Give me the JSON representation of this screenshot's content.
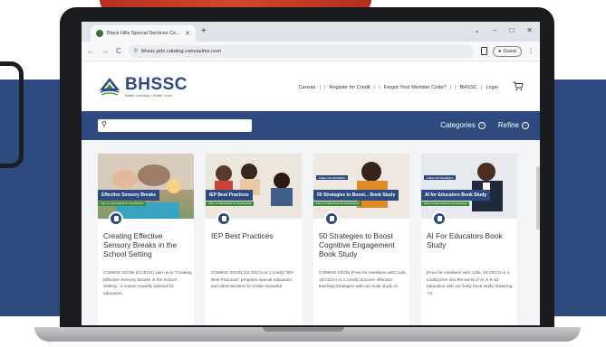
{
  "browser": {
    "tab_title": "Black Hills Special Services Co...",
    "tab_close": "✕",
    "new_tab": "+",
    "window_controls": [
      "⌄",
      "–",
      "□",
      "✕"
    ],
    "nav": {
      "back": "←",
      "forward": "→",
      "reload": "C"
    },
    "url": "bhssc.pds.catalog.canvaslms.com",
    "guest_label": "Guest",
    "menu": "⋮"
  },
  "site": {
    "logo_text": "BHSSC",
    "logo_tagline": "Better Learning • Better Lives",
    "nav": [
      "Canvas",
      "Register for Credit",
      "Forgot Your Member Code?",
      "BHSSC",
      "Login"
    ],
    "search_placeholder": "",
    "filters": [
      "Categories",
      "Refine"
    ]
  },
  "courses": [
    {
      "thumb_label": "Effective Sensory Breaks",
      "thumb_sub": "Click or credit inclusive for all participants",
      "pill": "",
      "title": "Creating Effective Sensory Breaks in the School Setting",
      "desc": "COMING SOON (6 CECH) Join us in \"Creating Effective Sensory Breaks in the School Setting,\" a course expertly tailored for educators,"
    },
    {
      "thumb_label": "IEP Best Practices",
      "thumb_sub": "Click or credit inclusive for all participants",
      "pill": "",
      "title": "IEP Best Practices",
      "desc": "COMING SOON (15 CECH or 1 credit) \"IEP Best Practices\" prepares special educators and administrators to create impactful"
    },
    {
      "thumb_label": "50 Strategies to Boost... Book Study",
      "thumb_sub": "Click or credit inclusive for all participants",
      "pill": "FREE FOR MEMBERS",
      "title": "50 Strategies to Boost Cognitive Engagement Book Study",
      "desc": "COMING SOON (Free for members with code, 15 CECH or 1 credit) Uncover effective teaching strategies with our book study on"
    },
    {
      "thumb_label": "AI for Educators Book Study",
      "thumb_sub": "Click or credit inclusive for all participants",
      "pill": "FREE FOR MEMBERS",
      "title": "AI For Educators Book Study",
      "desc": "[Free for members with code, 15 CECH or 1 credit] Dive into the world of AI in K-12 education with our lively book study, featuring \"AI"
    }
  ],
  "colors": {
    "brand_navy": "#2f4a7e",
    "accent_green": "#3d8a3a",
    "catalog_bg": "#f3f4f6"
  }
}
